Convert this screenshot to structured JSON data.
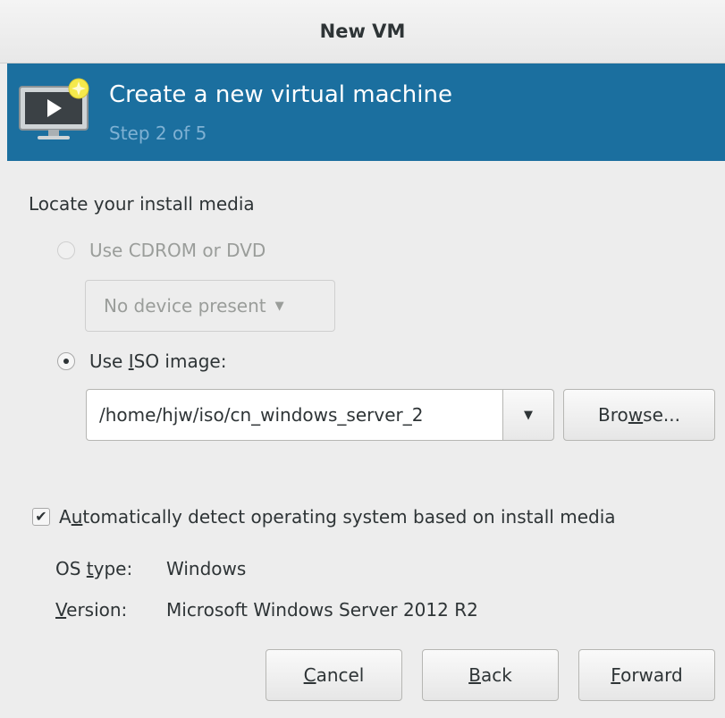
{
  "window": {
    "title": "New VM"
  },
  "header": {
    "title": "Create a new virtual machine",
    "step": "Step 2 of 5",
    "icon": "virtual-machine-monitor-icon"
  },
  "install": {
    "section_label": "Locate your install media",
    "cdrom_option": {
      "label": "Use CDROM or DVD",
      "checked": false,
      "enabled": false
    },
    "device_dropdown": {
      "value": "No device present",
      "enabled": false
    },
    "iso_option": {
      "label_prefix": "Use ",
      "mnemonic": "I",
      "label_suffix": "SO image:",
      "checked": true
    },
    "iso_path": "/home/hjw/iso/cn_windows_server_2",
    "browse_button": {
      "prefix": "Bro",
      "mnemonic": "w",
      "suffix": "se..."
    }
  },
  "os_detection": {
    "auto_detect": {
      "prefix": "A",
      "mnemonic": "u",
      "suffix": "tomatically detect operating system based on install media",
      "checked": true
    },
    "os_type_label": {
      "prefix": "OS ",
      "mnemonic": "t",
      "suffix": "ype:"
    },
    "os_type_value": "Windows",
    "version_label": {
      "mnemonic": "V",
      "suffix": "ersion:"
    },
    "version_value": "Microsoft Windows Server 2012 R2"
  },
  "footer": {
    "cancel": {
      "mnemonic": "C",
      "suffix": "ancel"
    },
    "back": {
      "mnemonic": "B",
      "suffix": "ack"
    },
    "forward": {
      "mnemonic": "F",
      "suffix": "orward"
    }
  },
  "colors": {
    "banner": "#1b6f9f",
    "step_text": "#7fb1d3",
    "window_bg": "#ededed",
    "icon_star": "#f5e94c"
  }
}
